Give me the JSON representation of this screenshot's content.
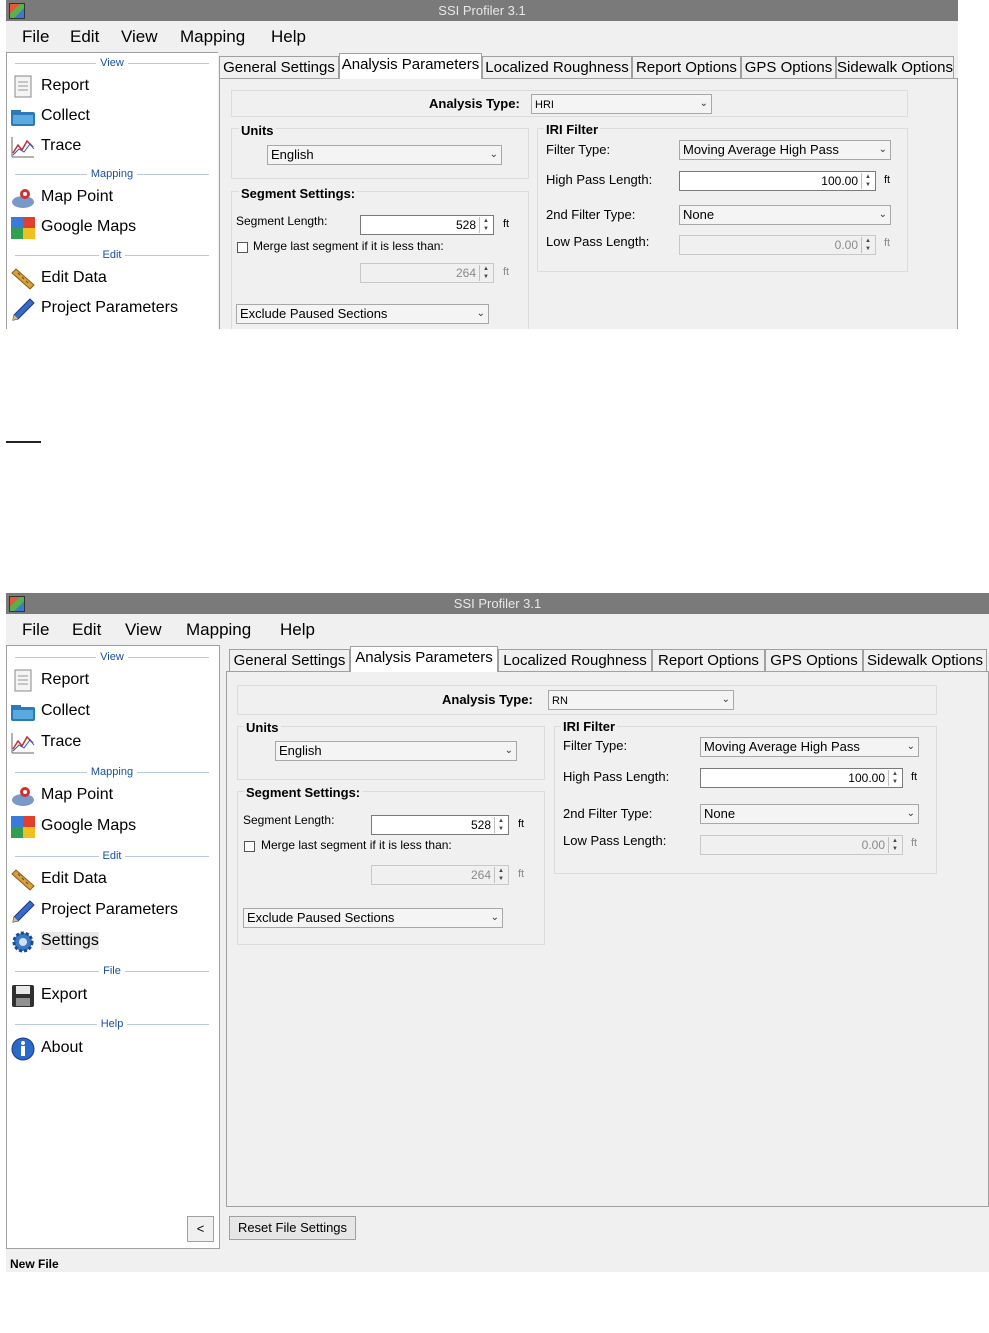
{
  "app": {
    "title": "SSI Profiler 3.1"
  },
  "menu": [
    "File",
    "Edit",
    "View",
    "Mapping",
    "Help"
  ],
  "sidebar": {
    "sections": {
      "view": "View",
      "mapping": "Mapping",
      "edit": "Edit",
      "file": "File",
      "help": "Help"
    },
    "items": {
      "report": "Report",
      "collect": "Collect",
      "trace": "Trace",
      "map_point": "Map Point",
      "google_maps": "Google Maps",
      "edit_data": "Edit Data",
      "project_parameters": "Project Parameters",
      "settings": "Settings",
      "export": "Export",
      "about": "About"
    },
    "collapse_button": "<",
    "icons": [
      "report-icon",
      "collect-icon",
      "trace-icon",
      "map-point-icon",
      "google-maps-icon",
      "edit-data-icon",
      "project-parameters-icon",
      "settings-icon",
      "export-icon",
      "about-icon"
    ]
  },
  "tabs": [
    "General Settings",
    "Analysis Parameters",
    "Localized Roughness",
    "Report Options",
    "GPS Options",
    "Sidewalk Options"
  ],
  "analysis": {
    "type_label": "Analysis Type:",
    "type_value_top": "HRI",
    "type_value_bottom": "RN",
    "units": {
      "title": "Units",
      "value": "English"
    },
    "segment": {
      "title": "Segment Settings:",
      "length_label": "Segment Length:",
      "length_value": "528",
      "unit": "ft",
      "merge_label": "Merge last segment if it is less than:",
      "merge_value": "264",
      "merge_unit": "ft",
      "exclude_value": "Exclude Paused Sections"
    },
    "iri": {
      "title": "IRI Filter",
      "filter_type_label": "Filter Type:",
      "filter_type_value": "Moving Average High Pass",
      "high_pass_label": "High Pass Length:",
      "high_pass_value": "100.00",
      "high_pass_unit": "ft",
      "second_filter_label": "2nd Filter Type:",
      "second_filter_value": "None",
      "low_pass_label": "Low Pass Length:",
      "low_pass_value": "0.00",
      "low_pass_unit": "ft"
    }
  },
  "buttons": {
    "reset": "Reset File Settings"
  },
  "status": {
    "text": "New File"
  }
}
